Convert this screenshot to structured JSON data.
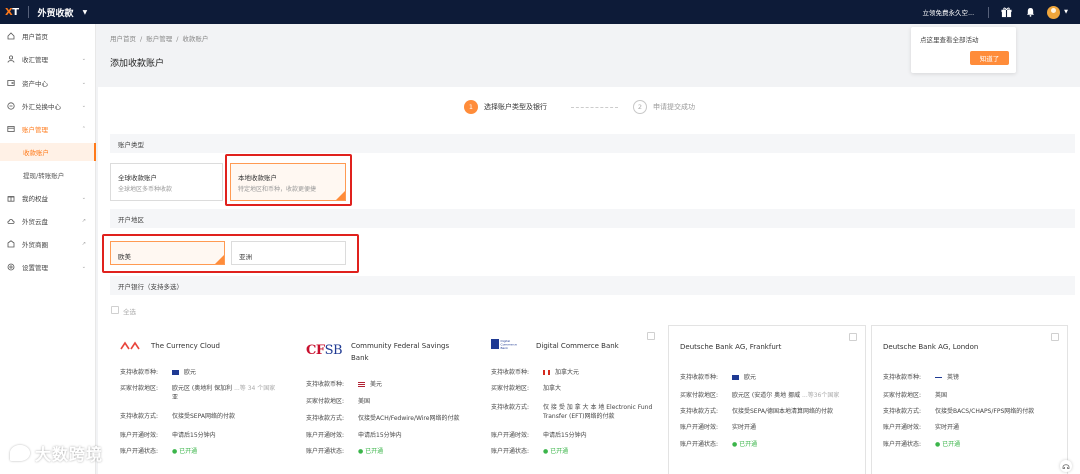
{
  "topbar": {
    "logo": "XT",
    "app_title": "外贸收款",
    "promo": "立领免费永久空...",
    "colors": {
      "bg": "#0d1b38",
      "accent": "#ff7a1a"
    }
  },
  "sidebar": {
    "items": [
      {
        "label": "用户首页",
        "icon": "home-icon"
      },
      {
        "label": "收汇管理",
        "icon": "user-icon"
      },
      {
        "label": "资产中心",
        "icon": "wallet-icon"
      },
      {
        "label": "外汇兑换中心",
        "icon": "exchange-icon"
      },
      {
        "label": "账户管理",
        "icon": "card-icon"
      },
      {
        "label": "收款账户"
      },
      {
        "label": "提现/转账账户"
      },
      {
        "label": "我的权益",
        "icon": "gift-icon"
      },
      {
        "label": "外贸云盘",
        "icon": "cloud-icon"
      },
      {
        "label": "外贸商圈",
        "icon": "store-icon"
      },
      {
        "label": "设置管理",
        "icon": "settings-icon"
      }
    ]
  },
  "breadcrumb": [
    "用户首页",
    "/",
    "账户管理",
    "/",
    "收款账户"
  ],
  "page_title": "添加收款账户",
  "notice": {
    "text": "点这里查看全部活动",
    "button": "知道了"
  },
  "steps": [
    {
      "num": "1",
      "label": "选择账户类型及银行"
    },
    {
      "num": "2",
      "label": "申请提交成功"
    }
  ],
  "account_type": {
    "section": "账户类型",
    "options": [
      {
        "title": "全球收款账户",
        "desc": "全球地区多币种收款"
      },
      {
        "title": "本地收款账户",
        "desc": "特定地区和币种，收款更便捷"
      }
    ]
  },
  "region": {
    "section": "开户地区",
    "options": [
      "欧美",
      "亚洲"
    ]
  },
  "banks_section": "开户银行（支持多选）",
  "select_all": "全选",
  "banks": [
    {
      "name": "The Currency Cloud",
      "rows": [
        {
          "k": "支持收款币种:",
          "v": "欧元"
        },
        {
          "k": "买家付款地区:",
          "v": "欧元区 (奥地利 保加利",
          "v2": "亚",
          "more": "...等 34 个国家"
        },
        {
          "k": "支持收款方式:",
          "v": "仅接受SEPA网络的付款"
        },
        {
          "k": "账户开通时效:",
          "v": "申请后15分钟内"
        },
        {
          "k": "账户开通状态:",
          "v": "● 已开通"
        }
      ]
    },
    {
      "name": "Community Federal Savings",
      "name2": "Bank",
      "logo": "CFSB",
      "rows": [
        {
          "k": "支持收款币种:",
          "v": "美元"
        },
        {
          "k": "买家付款地区:",
          "v": "美国"
        },
        {
          "k": "支持收款方式:",
          "v": "仅接受ACH/Fedwire/Wire网络的付款"
        },
        {
          "k": "账户开通时效:",
          "v": "申请后15分钟内"
        },
        {
          "k": "账户开通状态:",
          "v": "● 已开通"
        }
      ]
    },
    {
      "name": "Digital Commerce Bank",
      "logo": "Digital Commerce Bank",
      "rows": [
        {
          "k": "支持收款币种:",
          "v": "加拿大元"
        },
        {
          "k": "买家付款地区:",
          "v": "加拿大"
        },
        {
          "k": "支持收款方式:",
          "v": "仅 接 受 加 拿 大 本 地 Electronic Fund",
          "v2": "Transfer (EFT)网络的付款"
        },
        {
          "k": "账户开通时效:",
          "v": "申请后15分钟内"
        },
        {
          "k": "账户开通状态:",
          "v": "● 已开通"
        }
      ]
    },
    {
      "name": "Deutsche Bank AG, Frankfurt",
      "rows": [
        {
          "k": "支持收款币种:",
          "v": "欧元"
        },
        {
          "k": "买家付款地区:",
          "v": "欧元区 (安道尔 奥地 挪威",
          "more": "...等36个国家"
        },
        {
          "k": "支持收款方式:",
          "v": "仅接受SEPA/德国本地清算网络的付款"
        },
        {
          "k": "账户开通时效:",
          "v": "实时开通"
        },
        {
          "k": "账户开通状态:",
          "v": "● 已开通"
        }
      ]
    },
    {
      "name": "Deutsche Bank AG, London",
      "rows": [
        {
          "k": "支持收款币种:",
          "v": "英镑"
        },
        {
          "k": "买家付款地区:",
          "v": "英国"
        },
        {
          "k": "支持收款方式:",
          "v": "仅接受BACS/CHAPS/FPS网络的付款"
        },
        {
          "k": "账户开通时效:",
          "v": "实时开通"
        },
        {
          "k": "账户开通状态:",
          "v": "● 已开通"
        }
      ]
    }
  ],
  "watermark": "大数跨境"
}
